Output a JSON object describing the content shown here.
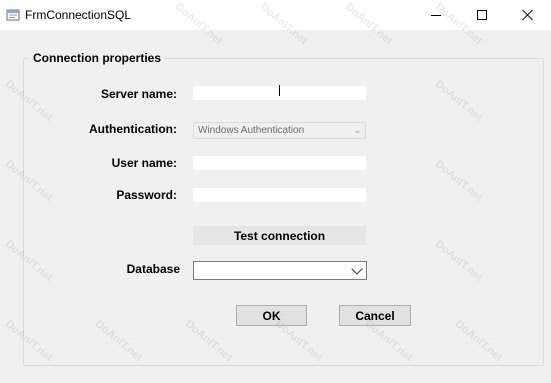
{
  "window": {
    "title": "FrmConnectionSQL"
  },
  "group": {
    "title": "Connection properties"
  },
  "form": {
    "server_label": "Server name:",
    "server_value": "",
    "auth_label": "Authentication:",
    "auth_value": "Windows Authentication",
    "user_label": "User name:",
    "user_value": "",
    "password_label": "Password:",
    "password_value": "",
    "test_button": "Test connection",
    "database_label": "Database",
    "database_value": ""
  },
  "buttons": {
    "ok": "OK",
    "cancel": "Cancel"
  },
  "icons": {
    "app": "form-icon",
    "minimize": "minimize-icon",
    "maximize": "maximize-icon",
    "close": "close-icon",
    "auth_dropdown": "chevron-down-icon",
    "db_dropdown": "chevron-down-icon"
  },
  "watermark": {
    "text": "DoAnIT.net"
  }
}
